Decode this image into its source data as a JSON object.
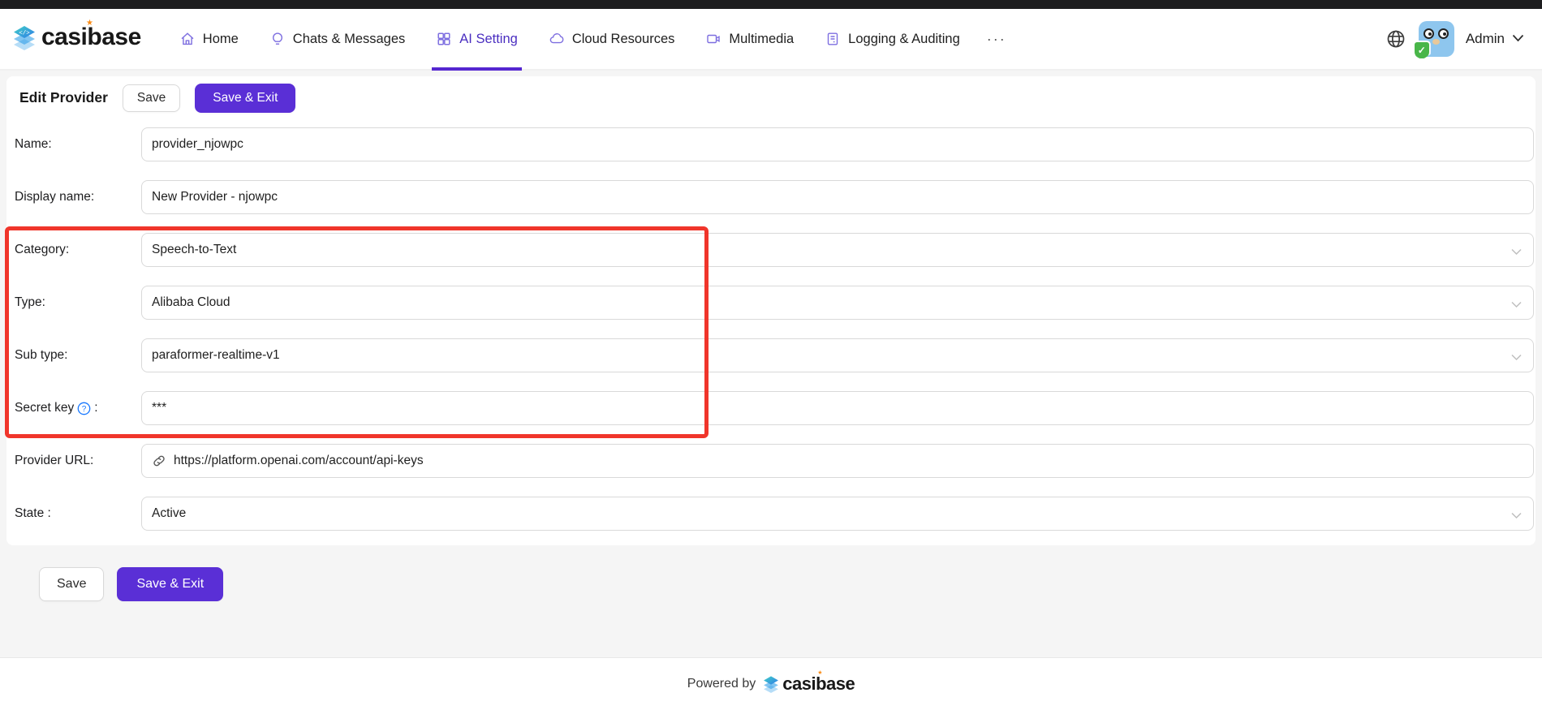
{
  "header": {
    "logo_text": "casibase",
    "nav": [
      {
        "label": "Home"
      },
      {
        "label": "Chats & Messages"
      },
      {
        "label": "AI Setting"
      },
      {
        "label": "Cloud Resources"
      },
      {
        "label": "Multimedia"
      },
      {
        "label": "Logging & Auditing"
      },
      {
        "label": "···"
      }
    ],
    "active_tab": "AI Setting",
    "user": {
      "name": "Admin"
    }
  },
  "toolbar": {
    "title": "Edit Provider",
    "save_label": "Save",
    "save_exit_label": "Save & Exit"
  },
  "form": {
    "rows": [
      {
        "label": "Name:",
        "value": "provider_njowpc",
        "type": "input"
      },
      {
        "label": "Display name:",
        "value": "New Provider - njowpc",
        "type": "input"
      },
      {
        "label": "Category:",
        "value": "Speech-to-Text",
        "type": "select"
      },
      {
        "label": "Type:",
        "value": "Alibaba Cloud",
        "type": "select"
      },
      {
        "label": "Sub type:",
        "value": "paraformer-realtime-v1",
        "type": "select"
      },
      {
        "label": "Secret key",
        "label_suffix": ":",
        "has_help_icon": true,
        "value": "***",
        "type": "input"
      },
      {
        "label": "Provider URL:",
        "value": "https://platform.openai.com/account/api-keys",
        "type": "input",
        "has_link_icon": true
      },
      {
        "label": "State :",
        "value": "Active",
        "type": "select"
      }
    ]
  },
  "bottom_actions": {
    "save_label": "Save",
    "save_exit_label": "Save & Exit"
  },
  "footer": {
    "powered_by": "Powered by",
    "logo_text": "casibase"
  },
  "colors": {
    "primary_purple": "#5a2fd6",
    "nav_icon_purple": "#7d6ee0",
    "annotation_red": "#f0352b",
    "help_blue": "#1677ff",
    "input_border": "#d9d9d9",
    "page_background": "#f5f5f5"
  }
}
